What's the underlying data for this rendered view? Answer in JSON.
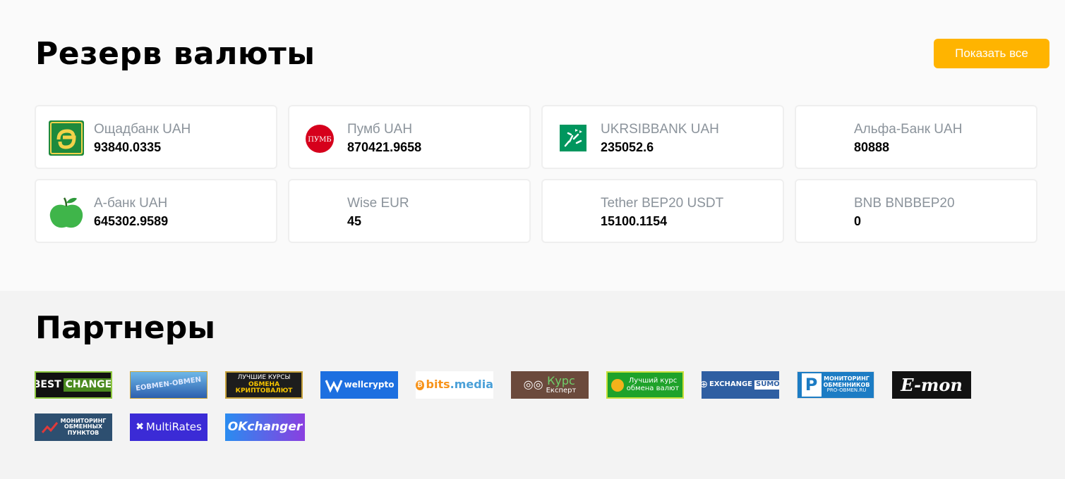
{
  "reserve": {
    "title": "Резерв валюты",
    "show_all_label": "Показать все",
    "accent_color": "#ffb400",
    "items": [
      {
        "name": "Ощадбанк UAH",
        "amount": "93840.0335",
        "icon": "oschadbank-logo-icon"
      },
      {
        "name": "Пумб UAH",
        "amount": "870421.9658",
        "icon": "pumb-logo-icon",
        "icon_text": "ПУМБ"
      },
      {
        "name": "UKRSIBBANK UAH",
        "amount": "235052.6",
        "icon": "ukrsibbank-logo-icon"
      },
      {
        "name": "Альфа-Банк UAH",
        "amount": "80888",
        "icon": ""
      },
      {
        "name": "А-банк UAH",
        "amount": "645302.9589",
        "icon": "abank-apple-icon"
      },
      {
        "name": "Wise EUR",
        "amount": "45",
        "icon": ""
      },
      {
        "name": "Tether BEP20 USDT",
        "amount": "15100.1154",
        "icon": ""
      },
      {
        "name": "BNB BNBBEP20",
        "amount": "0",
        "icon": ""
      }
    ]
  },
  "partners": {
    "title": "Партнеры",
    "logos": [
      {
        "id": "bestchange",
        "text1": "BEST",
        "text2": "CHANGE"
      },
      {
        "id": "eobmen",
        "text1": "EOBMEN-OBMEN"
      },
      {
        "id": "luchshie-kursy",
        "text1": "ЛУЧШИЕ КУРСЫ",
        "text2": "ОБМЕНА",
        "text3": "КРИПТОВАЛЮТ"
      },
      {
        "id": "wellcrypto",
        "text1": "wellcrypto"
      },
      {
        "id": "bitsmedia",
        "text1": "bits",
        "text2": ".media"
      },
      {
        "id": "kurs-expert",
        "text1": "Курс",
        "text2": "Експерт"
      },
      {
        "id": "luchshiy-kurs",
        "text1": "Лучший курс",
        "text2": "обмена валют"
      },
      {
        "id": "exchangesumo",
        "text1": "EXCHANGE",
        "text2": "SUMO"
      },
      {
        "id": "pro-obmen",
        "text1": "МОНИТОРИНГ",
        "text2": "ОБМЕННИКОВ",
        "text3": "PRO-OBMEN.RU"
      },
      {
        "id": "emon",
        "text1": "E-mon"
      },
      {
        "id": "monitoring-punktov",
        "text1": "МОНИТОРИНГ",
        "text2": "ОБМЕННЫХ",
        "text3": "ПУНКТОВ"
      },
      {
        "id": "multirates",
        "text1": "MultiRates"
      },
      {
        "id": "okchanger",
        "text1": "OKchanger"
      }
    ]
  }
}
